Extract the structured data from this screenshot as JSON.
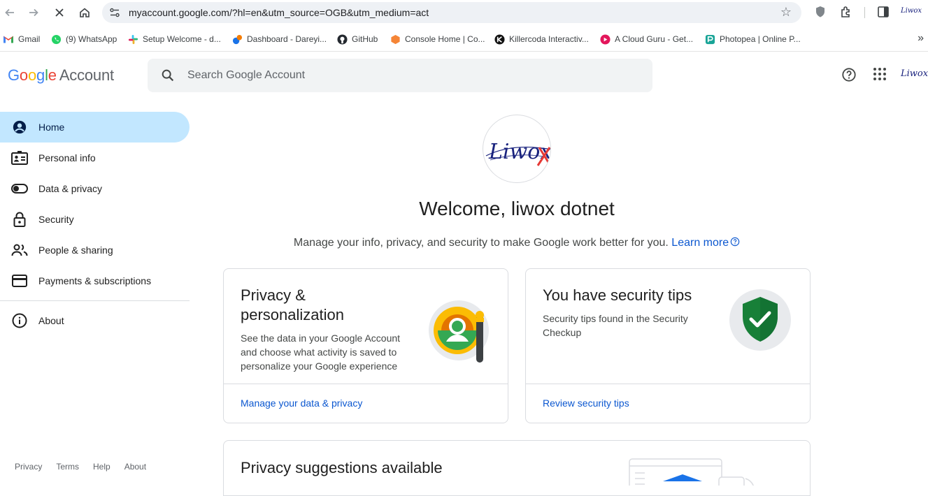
{
  "browser": {
    "url": "myaccount.google.com/?hl=en&utm_source=OGB&utm_medium=act",
    "bookmarks": [
      {
        "label": "Gmail",
        "icon": "gmail-icon"
      },
      {
        "label": "(9) WhatsApp",
        "icon": "whatsapp-icon"
      },
      {
        "label": "Setup Welcome - d...",
        "icon": "slack-icon"
      },
      {
        "label": "Dashboard - Dareyi...",
        "icon": "dareyio-icon"
      },
      {
        "label": "GitHub",
        "icon": "github-icon"
      },
      {
        "label": "Console Home | Co...",
        "icon": "aws-icon"
      },
      {
        "label": "Killercoda Interactiv...",
        "icon": "killercoda-icon"
      },
      {
        "label": "A Cloud Guru - Get...",
        "icon": "acloudguru-icon"
      },
      {
        "label": "Photopea | Online P...",
        "icon": "photopea-icon"
      }
    ],
    "profile_label": "Liwox"
  },
  "header": {
    "logo_letters": [
      "G",
      "o",
      "o",
      "g",
      "l",
      "e"
    ],
    "logo_suffix": "Account",
    "search_placeholder": "Search Google Account",
    "avatar_label": "Liwox"
  },
  "sidebar": {
    "items": [
      {
        "label": "Home",
        "icon": "account-circle-icon",
        "active": true
      },
      {
        "label": "Personal info",
        "icon": "id-card-icon"
      },
      {
        "label": "Data & privacy",
        "icon": "toggle-icon"
      },
      {
        "label": "Security",
        "icon": "lock-icon"
      },
      {
        "label": "People & sharing",
        "icon": "people-icon"
      },
      {
        "label": "Payments & subscriptions",
        "icon": "credit-card-icon"
      }
    ],
    "about_label": "About",
    "footer": [
      "Privacy",
      "Terms",
      "Help",
      "About"
    ]
  },
  "main": {
    "avatar_text": "Liwox",
    "welcome": "Welcome, liwox dotnet",
    "subline": "Manage your info, privacy, and security to make Google work better for you.",
    "learn_more": "Learn more",
    "cards": [
      {
        "title_line1": "Privacy &",
        "title_line2": "personalization",
        "description": "See the data in your Google Account and choose what activity is saved to personalize your Google experience",
        "link": "Manage your data & privacy"
      },
      {
        "title": "You have security tips",
        "description": "Security tips found in the Security Checkup",
        "link": "Review security tips"
      }
    ],
    "suggestions_title": "Privacy suggestions available"
  },
  "colors": {
    "active_nav_bg": "#c2e7ff",
    "link": "#0b57d0",
    "shield_green": "#188038"
  }
}
